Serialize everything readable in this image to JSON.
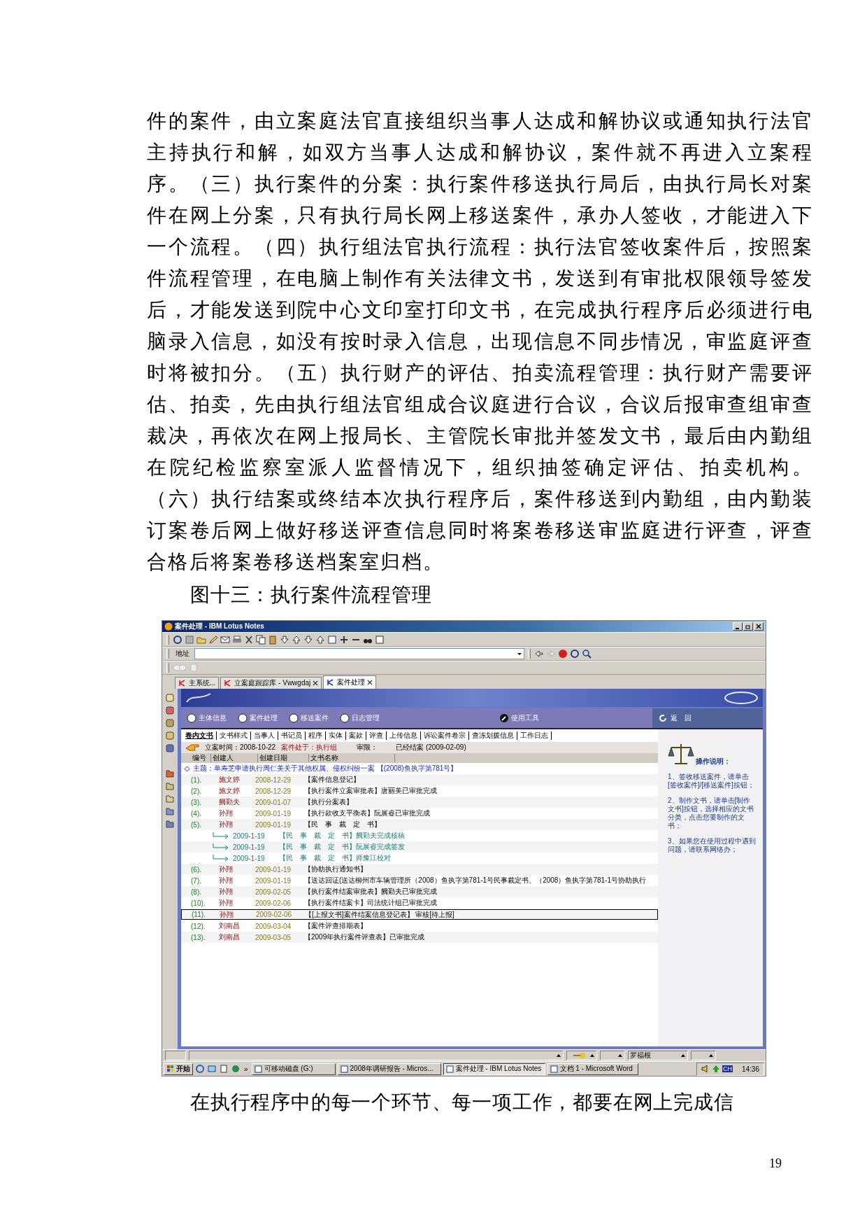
{
  "document": {
    "paragraph": "件的案件，由立案庭法官直接组织当事人达成和解协议或通知执行法官主持执行和解，如双方当事人达成和解协议，案件就不再进入立案程序。（三）执行案件的分案：执行案件移送执行局后，由执行局长对案件在网上分案，只有执行局长网上移送案件，承办人签收，才能进入下一个流程。（四）执行组法官执行流程：执行法官签收案件后，按照案件流程管理，在电脑上制作有关法律文书，发送到有审批权限领导签发后，才能发送到院中心文印室打印文书，在完成执行程序后必须进行电脑录入信息，如没有按时录入信息，出现信息不同步情况，审监庭评查时将被扣分。（五）执行财产的评估、拍卖流程管理：执行财产需要评估、拍卖，先由执行组法官组成合议庭进行合议，合议后报审查组审查裁决，再依次在网上报局长、主管院长审批并签发文书，最后由内勤组在院纪检监察室派人监督情况下，组织抽签确定评估、拍卖机构。（六）执行结案或终结本次执行程序后，案件移送到内勤组，由内勤装订案卷后网上做好移送评查信息同时将案卷移送审监庭进行评查，评查合格后将案卷移送档案室归档。",
    "caption": "图十三：执行案件流程管理",
    "after_text": "在执行程序中的每一个环节、每一项工作，都要在网上完成信",
    "page_number": "19"
  },
  "window": {
    "title": "案件处理 - IBM Lotus Notes"
  },
  "address_bar": {
    "label": "地址"
  },
  "tabs": [
    {
      "label": "主系统...",
      "selected": false,
      "closable": false
    },
    {
      "label": "立案庭跟踪库 - Vwwgdaj",
      "selected": false,
      "closable": true
    },
    {
      "label": "案件处理",
      "selected": true,
      "closable": true
    }
  ],
  "nav_menu": [
    {
      "label": "主体信息"
    },
    {
      "label": "案件处理"
    },
    {
      "label": "移送案件"
    },
    {
      "label": "日志管理"
    }
  ],
  "tools": "使用工具",
  "back": "返　回",
  "doc_tabs": [
    {
      "label": "卷内文书",
      "selected": true
    },
    {
      "label": "文书样式",
      "selected": false
    },
    {
      "label": "当事人",
      "selected": false
    },
    {
      "label": "书记员",
      "selected": false
    },
    {
      "label": "程序",
      "selected": false
    },
    {
      "label": "实体",
      "selected": false
    },
    {
      "label": "案款",
      "selected": false
    },
    {
      "label": "评查",
      "selected": false
    },
    {
      "label": "上传信息",
      "selected": false
    },
    {
      "label": "诉讼案件卷宗",
      "selected": false
    },
    {
      "label": "查冻划拨信息",
      "selected": false
    },
    {
      "label": "工作日志",
      "selected": false
    }
  ],
  "case_info": {
    "filing": "立案时间：2008-10-22",
    "stage": "案件处于：执行组",
    "limit_label": "审限：",
    "limit_value": "已经结案 (2009-02-09)"
  },
  "table": {
    "columns": [
      "编号",
      "创建人",
      "创建日期",
      "文书名称"
    ],
    "topic": "主题：单寿芝申请执行周仁美关于其他权属、侵权纠纷一案 【(2008)鱼执字第781号】",
    "rows": [
      {
        "number": "(1).",
        "creator": "施文婷",
        "date": "2008-12-29",
        "title": "【案件信息登记】",
        "selected": false
      },
      {
        "number": "(2).",
        "creator": "施文婷",
        "date": "2008-12-29",
        "title": "【执行案件立案审批表】唐丽美已审批完成",
        "selected": false
      },
      {
        "number": "(3).",
        "creator": "阙勤夫",
        "date": "2009-01-07",
        "title": "【执行分案表】",
        "selected": false
      },
      {
        "number": "(4).",
        "creator": "孙翔",
        "date": "2009-01-19",
        "title": "【执行款收支平衡表】阮展睿已审批完成",
        "selected": false
      },
      {
        "number": "(5).",
        "creator": "孙翔",
        "date": "2009-01-19",
        "title": "【民　事　裁　定　书】",
        "selected": false,
        "children": [
          {
            "date": "2009-1-19",
            "title": "【民　事　裁　定　书】阙勤夫完成核稿"
          },
          {
            "date": "2009-1-19",
            "title": "【民　事　裁　定　书】阮展睿完成签发"
          },
          {
            "date": "2009-1-19",
            "title": "【民　事　裁　定　书】师豫江校对"
          }
        ]
      },
      {
        "number": "(6).",
        "creator": "孙翔",
        "date": "2009-01-19",
        "title": "【协助执行通知书】",
        "selected": false
      },
      {
        "number": "(7).",
        "creator": "孙翔",
        "date": "2009-01-19",
        "title": "【送达回证(送达柳州市车辆管理所（2008）鱼执字第781-1号民事裁定书、（2008）鱼执字第781-1号协助执行",
        "selected": false
      },
      {
        "number": "(8).",
        "creator": "孙翔",
        "date": "2009-02-05",
        "title": "【执行案件结案审批表】阙勤夫已审批完成",
        "selected": false
      },
      {
        "number": "(10).",
        "creator": "孙翔",
        "date": "2009-02-06",
        "title": "【执行案件结案卡】司法统计组已审批完成",
        "selected": false
      },
      {
        "number": "(11).",
        "creator": "孙翔",
        "date": "2009-02-06",
        "title": "【[上报文书]案件结案信息登记表】 审核[待上报]",
        "selected": true
      },
      {
        "number": "(12).",
        "creator": "刘南昌",
        "date": "2009-03-04",
        "title": "【案件评查排期表】",
        "selected": false
      },
      {
        "number": "(13).",
        "creator": "刘南昌",
        "date": "2009-03-05",
        "title": "【2009年执行案件评查表】已审批完成",
        "selected": false
      }
    ]
  },
  "help": {
    "title": "操作说明：",
    "items": [
      "1、签收移送案件，请单击[签收案件]/[移送案件]按钮；",
      "2、制作文书，请单击[制作文书]按钮，选择相应的文书分类，点击您要制作的文书；",
      "3、如果您在使用过程中遇到问题，请联系网络办；"
    ]
  },
  "status_bar": {
    "user": "罗福根"
  },
  "taskbar": {
    "start": "开始",
    "more": "»",
    "tasks": [
      {
        "label": "可移动磁盘 (G:)",
        "selected": false
      },
      {
        "label": "2008年调研报告 - Micros...",
        "selected": false
      },
      {
        "label": "案件处理 - IBM Lotus Notes",
        "selected": true
      },
      {
        "label": "文档 1 - Microsoft Word",
        "selected": false
      }
    ],
    "ime": "CH",
    "clock": "14:36"
  }
}
